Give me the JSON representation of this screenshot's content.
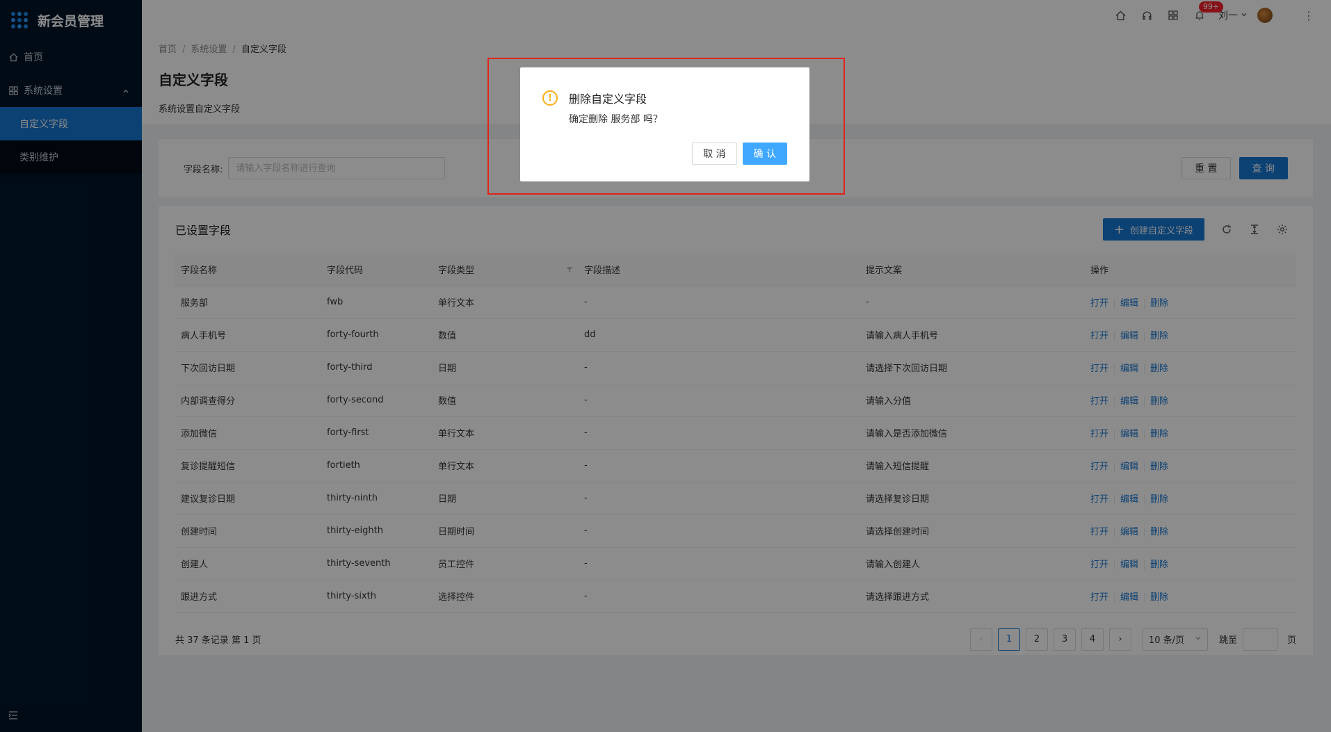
{
  "app": {
    "title": "新会员管理"
  },
  "sidebar": {
    "home": "首页",
    "system": "系统设置",
    "sub_items": [
      "自定义字段",
      "类别维护"
    ]
  },
  "header": {
    "notification_count": "99+",
    "user_name": "刘一"
  },
  "breadcrumb": [
    "首页",
    "系统设置",
    "自定义字段"
  ],
  "page": {
    "title": "自定义字段",
    "description": "系统设置自定义字段"
  },
  "search": {
    "label": "字段名称:",
    "placeholder": "请输入字段名称进行查询",
    "reset": "重 置",
    "query": "查 询"
  },
  "table": {
    "title": "已设置字段",
    "create_button": "创建自定义字段",
    "columns": [
      "字段名称",
      "字段代码",
      "字段类型",
      "字段描述",
      "提示文案",
      "操作"
    ],
    "actions": [
      "打开",
      "编辑",
      "删除"
    ],
    "rows": [
      [
        "服务部",
        "fwb",
        "单行文本",
        "-",
        "-"
      ],
      [
        "病人手机号",
        "forty-fourth",
        "数值",
        "dd",
        "请输入病人手机号"
      ],
      [
        "下次回访日期",
        "forty-third",
        "日期",
        "-",
        "请选择下次回访日期"
      ],
      [
        "内部调查得分",
        "forty-second",
        "数值",
        "-",
        "请输入分值"
      ],
      [
        "添加微信",
        "forty-first",
        "单行文本",
        "-",
        "请输入是否添加微信"
      ],
      [
        "复诊提醒短信",
        "fortieth",
        "单行文本",
        "-",
        "请输入短信提醒"
      ],
      [
        "建议复诊日期",
        "thirty-ninth",
        "日期",
        "-",
        "请选择复诊日期"
      ],
      [
        "创建时间",
        "thirty-eighth",
        "日期时间",
        "-",
        "请选择创建时间"
      ],
      [
        "创建人",
        "thirty-seventh",
        "员工控件",
        "-",
        "请输入创建人"
      ],
      [
        "跟进方式",
        "thirty-sixth",
        "选择控件",
        "-",
        "请选择跟进方式"
      ]
    ]
  },
  "pagination": {
    "total_text": "共 37 条记录 第 1 页",
    "pages": [
      "1",
      "2",
      "3",
      "4"
    ],
    "page_size": "10 条/页",
    "jump_label": "跳至",
    "page_unit": "页"
  },
  "modal": {
    "title": "删除自定义字段",
    "content": "确定删除 服务部 吗？",
    "cancel": "取 消",
    "confirm": "确 认"
  }
}
